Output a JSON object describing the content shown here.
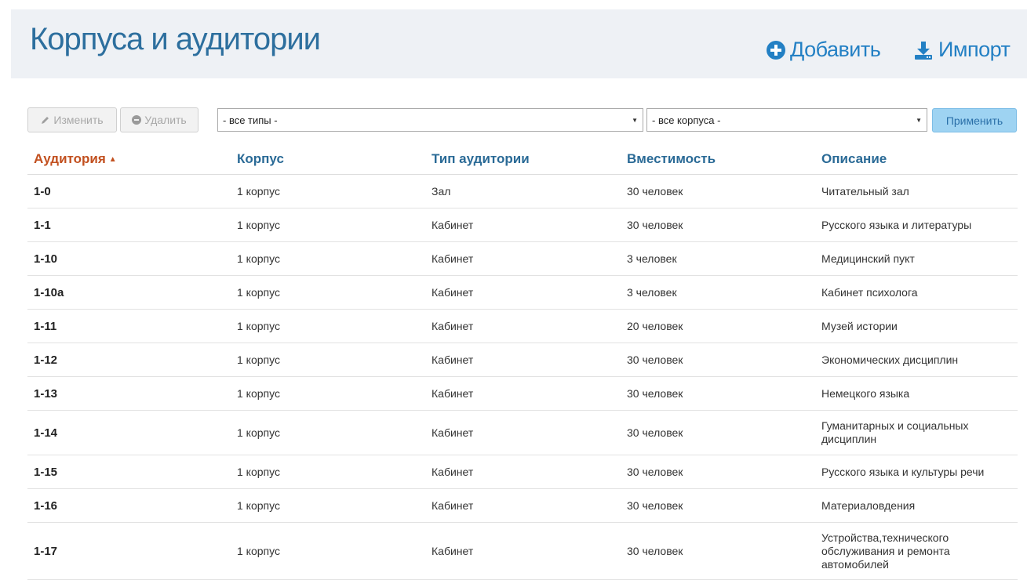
{
  "header": {
    "title": "Корпуса и аудитории",
    "add_label": "Добавить",
    "import_label": "Импорт"
  },
  "toolbar": {
    "edit_label": "Изменить",
    "delete_label": "Удалить",
    "type_filter_value": "- все типы -",
    "building_filter_value": "- все корпуса -",
    "apply_label": "Применить"
  },
  "table": {
    "columns": [
      "Аудитория",
      "Корпус",
      "Тип аудитории",
      "Вместимость",
      "Описание"
    ],
    "sorted_column": "Аудитория",
    "sort_direction": "ascending",
    "rows": [
      {
        "room": "1-0",
        "building": "1 корпус",
        "type": "Зал",
        "capacity": "30 человек",
        "description": "Читательный зал"
      },
      {
        "room": "1-1",
        "building": "1 корпус",
        "type": "Кабинет",
        "capacity": "30 человек",
        "description": "Русского языка и литературы"
      },
      {
        "room": "1-10",
        "building": "1 корпус",
        "type": "Кабинет",
        "capacity": "3 человек",
        "description": "Медицинский пукт"
      },
      {
        "room": "1-10a",
        "building": "1 корпус",
        "type": "Кабинет",
        "capacity": "3 человек",
        "description": "Кабинет психолога"
      },
      {
        "room": "1-11",
        "building": "1 корпус",
        "type": "Кабинет",
        "capacity": "20 человек",
        "description": "Музей истории"
      },
      {
        "room": "1-12",
        "building": "1 корпус",
        "type": "Кабинет",
        "capacity": "30 человек",
        "description": "Экономических дисциплин"
      },
      {
        "room": "1-13",
        "building": "1 корпус",
        "type": "Кабинет",
        "capacity": "30 человек",
        "description": "Немецкого языка"
      },
      {
        "room": "1-14",
        "building": "1 корпус",
        "type": "Кабинет",
        "capacity": "30 человек",
        "description": "Гуманитарных и социальных дисциплин"
      },
      {
        "room": "1-15",
        "building": "1 корпус",
        "type": "Кабинет",
        "capacity": "30 человек",
        "description": "Русского языка и культуры речи"
      },
      {
        "room": "1-16",
        "building": "1 корпус",
        "type": "Кабинет",
        "capacity": "30 человек",
        "description": "Материаловдения"
      },
      {
        "room": "1-17",
        "building": "1 корпус",
        "type": "Кабинет",
        "capacity": "30 человек",
        "description": "Устройства,технического обслуживания и ремонта автомобилей"
      }
    ]
  },
  "colors": {
    "accent": "#2380c4",
    "title": "#2d6f9e",
    "sorted_header": "#c2501f",
    "header_bg": "#eef1f5",
    "apply_button": "#9ed3f2"
  },
  "icons": {
    "add": "plus-circle-icon",
    "import": "download-icon",
    "edit": "pencil-icon",
    "delete": "minus-circle-icon",
    "sort": "sort-asc-icon"
  }
}
